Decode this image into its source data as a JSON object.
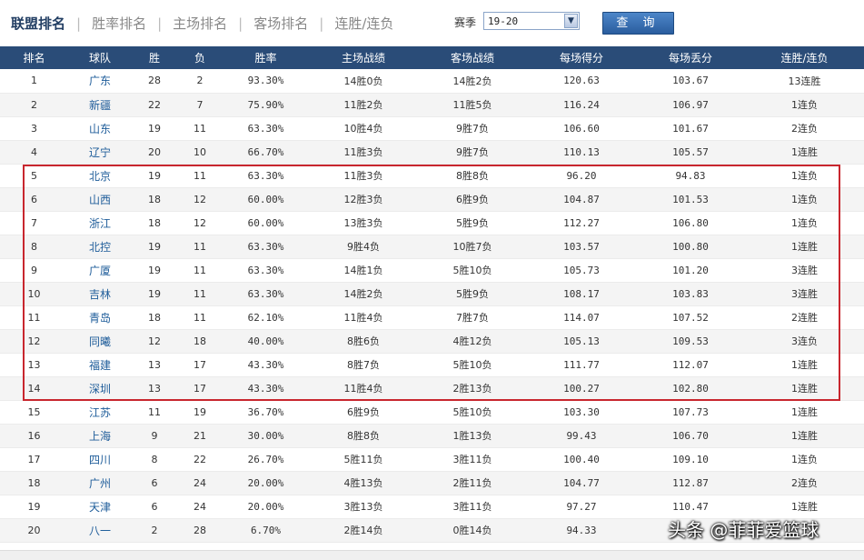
{
  "nav": {
    "tabs": [
      "联盟排名",
      "胜率排名",
      "主场排名",
      "客场排名",
      "连胜/连负"
    ],
    "active_tab": 0
  },
  "filter": {
    "season_label": "赛季",
    "season_value": "19-20",
    "query_button": "查 询"
  },
  "table": {
    "headers": [
      "排名",
      "球队",
      "胜",
      "负",
      "胜率",
      "主场战绩",
      "客场战绩",
      "每场得分",
      "每场丢分",
      "连胜/连负"
    ],
    "rows": [
      [
        "1",
        "广东",
        "28",
        "2",
        "93.30%",
        "14胜0负",
        "14胜2负",
        "120.63",
        "103.67",
        "13连胜"
      ],
      [
        "2",
        "新疆",
        "22",
        "7",
        "75.90%",
        "11胜2负",
        "11胜5负",
        "116.24",
        "106.97",
        "1连负"
      ],
      [
        "3",
        "山东",
        "19",
        "11",
        "63.30%",
        "10胜4负",
        "9胜7负",
        "106.60",
        "101.67",
        "2连负"
      ],
      [
        "4",
        "辽宁",
        "20",
        "10",
        "66.70%",
        "11胜3负",
        "9胜7负",
        "110.13",
        "105.57",
        "1连胜"
      ],
      [
        "5",
        "北京",
        "19",
        "11",
        "63.30%",
        "11胜3负",
        "8胜8负",
        "96.20",
        "94.83",
        "1连负"
      ],
      [
        "6",
        "山西",
        "18",
        "12",
        "60.00%",
        "12胜3负",
        "6胜9负",
        "104.87",
        "101.53",
        "1连负"
      ],
      [
        "7",
        "浙江",
        "18",
        "12",
        "60.00%",
        "13胜3负",
        "5胜9负",
        "112.27",
        "106.80",
        "1连负"
      ],
      [
        "8",
        "北控",
        "19",
        "11",
        "63.30%",
        "9胜4负",
        "10胜7负",
        "103.57",
        "100.80",
        "1连胜"
      ],
      [
        "9",
        "广厦",
        "19",
        "11",
        "63.30%",
        "14胜1负",
        "5胜10负",
        "105.73",
        "101.20",
        "3连胜"
      ],
      [
        "10",
        "吉林",
        "19",
        "11",
        "63.30%",
        "14胜2负",
        "5胜9负",
        "108.17",
        "103.83",
        "3连胜"
      ],
      [
        "11",
        "青岛",
        "18",
        "11",
        "62.10%",
        "11胜4负",
        "7胜7负",
        "114.07",
        "107.52",
        "2连胜"
      ],
      [
        "12",
        "同曦",
        "12",
        "18",
        "40.00%",
        "8胜6负",
        "4胜12负",
        "105.13",
        "109.53",
        "3连负"
      ],
      [
        "13",
        "福建",
        "13",
        "17",
        "43.30%",
        "8胜7负",
        "5胜10负",
        "111.77",
        "112.07",
        "1连胜"
      ],
      [
        "14",
        "深圳",
        "13",
        "17",
        "43.30%",
        "11胜4负",
        "2胜13负",
        "100.27",
        "102.80",
        "1连胜"
      ],
      [
        "15",
        "江苏",
        "11",
        "19",
        "36.70%",
        "6胜9负",
        "5胜10负",
        "103.30",
        "107.73",
        "1连胜"
      ],
      [
        "16",
        "上海",
        "9",
        "21",
        "30.00%",
        "8胜8负",
        "1胜13负",
        "99.43",
        "106.70",
        "1连胜"
      ],
      [
        "17",
        "四川",
        "8",
        "22",
        "26.70%",
        "5胜11负",
        "3胜11负",
        "100.40",
        "109.10",
        "1连负"
      ],
      [
        "18",
        "广州",
        "6",
        "24",
        "20.00%",
        "4胜13负",
        "2胜11负",
        "104.77",
        "112.87",
        "2连负"
      ],
      [
        "19",
        "天津",
        "6",
        "24",
        "20.00%",
        "3胜13负",
        "3胜11负",
        "97.27",
        "110.47",
        "1连胜"
      ],
      [
        "20",
        "八一",
        "2",
        "28",
        "6.70%",
        "2胜14负",
        "0胜14负",
        "94.33",
        "",
        ""
      ]
    ]
  },
  "watermark": "头条 @菲菲爱篮球",
  "colors": {
    "header_bg": "#2a4c78",
    "team_link": "#1f5d9a",
    "highlight_border": "#c8262e",
    "button": "#2a5d9e"
  }
}
